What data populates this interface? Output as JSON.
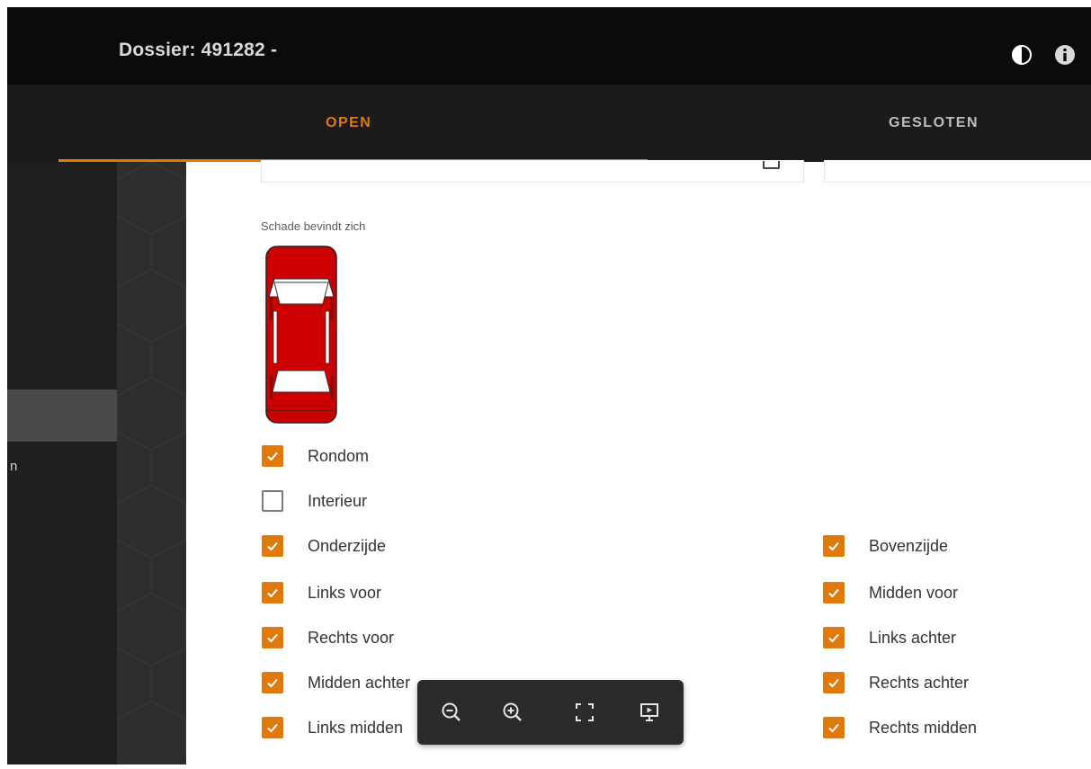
{
  "header": {
    "title": "Dossier: 491282 -",
    "icons": [
      "contrast-icon",
      "info-icon"
    ]
  },
  "tabs": [
    {
      "label": "OPEN",
      "active": true
    },
    {
      "label": "GESLOTEN",
      "active": false
    }
  ],
  "colors": {
    "accent": "#e07a0c",
    "topbar": "#0b0b0b",
    "tabbar": "#1b1b1b",
    "car_body": "#cc0000"
  },
  "sidebar": {
    "partial_text": "n"
  },
  "damage": {
    "label": "Schade bevindt zich",
    "options_left": [
      {
        "label": "Rondom",
        "checked": true
      },
      {
        "label": "Interieur",
        "checked": false
      },
      {
        "label": "Onderzijde",
        "checked": true
      },
      {
        "label": "Links voor",
        "checked": true
      },
      {
        "label": "Rechts voor",
        "checked": true
      },
      {
        "label": "Midden achter",
        "checked": true
      },
      {
        "label": "Links midden",
        "checked": true
      }
    ],
    "options_right": [
      {
        "label": "Bovenzijde",
        "checked": true
      },
      {
        "label": "Midden voor",
        "checked": true
      },
      {
        "label": "Links achter",
        "checked": true
      },
      {
        "label": "Rechts achter",
        "checked": true
      },
      {
        "label": "Rechts midden",
        "checked": true
      }
    ]
  },
  "viewer_toolbar": {
    "buttons": [
      "zoom-out-icon",
      "zoom-in-icon",
      "fit-screen-icon",
      "presentation-icon"
    ]
  }
}
